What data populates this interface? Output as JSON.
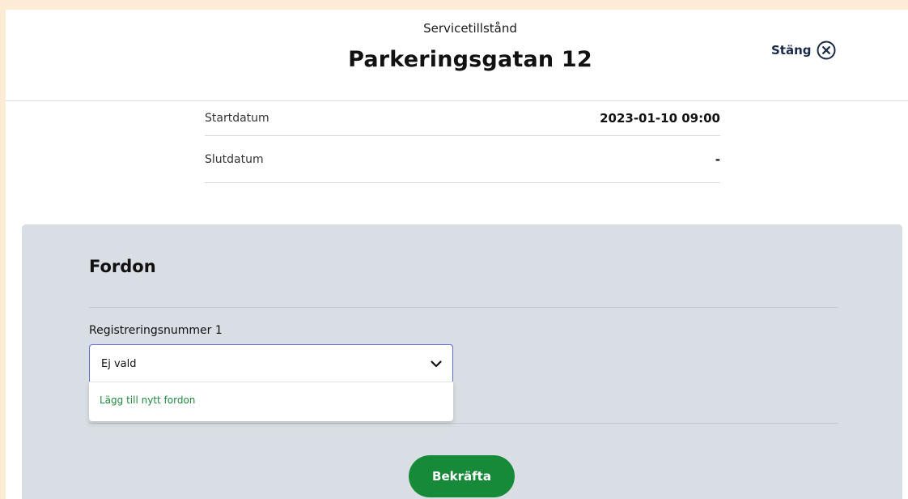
{
  "header": {
    "subtitle": "Servicetillstånd",
    "title": "Parkeringsgatan 12",
    "close_label": "Stäng",
    "close_icon": "close-circle-icon"
  },
  "details": [
    {
      "label": "Startdatum",
      "value": "2023-01-10 09:00"
    },
    {
      "label": "Slutdatum",
      "value": "-"
    }
  ],
  "vehicle": {
    "section_title": "Fordon",
    "field_label": "Registreringsnummer 1",
    "select_value": "Ej vald",
    "options": [
      "Lägg till nytt fordon"
    ],
    "confirm_label": "Bekräfta"
  },
  "colors": {
    "page_background": "#fdebd6",
    "section_background": "#d8dee3",
    "accent_green": "#178a3a",
    "option_green": "#1e8a3c",
    "focus_border": "#5c6bd6",
    "close_navy": "#1a2b4a"
  }
}
